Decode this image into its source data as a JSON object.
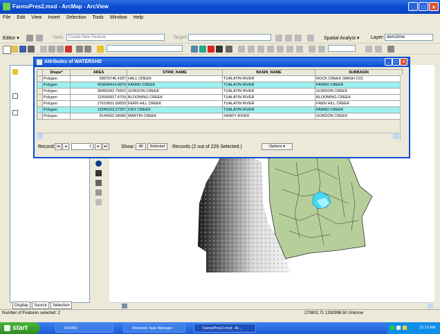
{
  "window": {
    "title": "FannoPres2.mxd - ArcMap - ArcView"
  },
  "menu": [
    "File",
    "Edit",
    "View",
    "Insert",
    "Selection",
    "Tools",
    "Window",
    "Help"
  ],
  "editor_toolbar": {
    "editor_label": "Editor ▾",
    "task_label": "Task:",
    "task_value": "Create New Feature",
    "target_label": "Target:",
    "spatial_analyst_label": "Spatial Analyst ▾",
    "layer_label": "Layer:",
    "layer_value": "dem10nw"
  },
  "attr_table": {
    "title": "Attributes of WATERSHD",
    "columns": [
      "",
      "Shape*",
      "AREA",
      "STRM_NAME",
      "BASIN_NAME",
      "SUBBASIN"
    ],
    "rows": [
      {
        "shape": "Polygon",
        "area": "68376746.4187",
        "strm": "HALL CREEK",
        "basin": "TUALATIN RIVER",
        "subbasin": "ROCK CREEK (WASH CO)",
        "selected": false
      },
      {
        "shape": "Polygon",
        "area": "420699414.6679",
        "strm": "FANNO CREEK",
        "basin": "TUALATIN RIVER",
        "subbasin": "FANNO CREEK",
        "selected": true
      },
      {
        "shape": "Polygon",
        "area": "36459342.75562",
        "strm": "GORDON CREEK",
        "basin": "TUALATIN RIVER",
        "subbasin": "GORDON CREEK",
        "selected": false
      },
      {
        "shape": "Polygon",
        "area": "120000917.4709",
        "strm": "BLOOMING CREEK",
        "basin": "TUALATIN RIVER",
        "subbasin": "BLOOMING CREEK",
        "selected": false
      },
      {
        "shape": "Polygon",
        "area": "27610651.50833",
        "strm": "FERN HILL CREEK",
        "basin": "TUALATIN RIVER",
        "subbasin": "FREN HILL CREEK",
        "selected": false
      },
      {
        "shape": "Polygon",
        "area": "13245223.27357",
        "strm": "IVEY CREEK",
        "basin": "TUALATIN RIVER",
        "subbasin": "FANNO CREEK",
        "selected": true
      },
      {
        "shape": "Polygon",
        "area": "8149932.34586",
        "strm": "MARTIN CREEK",
        "basin": "SANDY RIVER",
        "subbasin": "GORDON CREEK",
        "selected": false
      }
    ],
    "record_label": "Record:",
    "record_value": "1",
    "show_label": "Show:",
    "all_label": "All",
    "selected_label": "Selected",
    "records_text": "Records (2 out of 229 Selected.)",
    "options_label": "Options ▾"
  },
  "toc_tabs": [
    "Display",
    "Source",
    "Selection"
  ],
  "status": {
    "left": "Number of Features selected: 2",
    "coords": "270802.71  1392998.50 Unknow"
  },
  "taskbar": {
    "start": "start",
    "tasks": [
      "FANNO",
      "Windows Task Manager",
      "FannoPres2.mxd - Ar..."
    ],
    "clock": "12:12 AM"
  }
}
